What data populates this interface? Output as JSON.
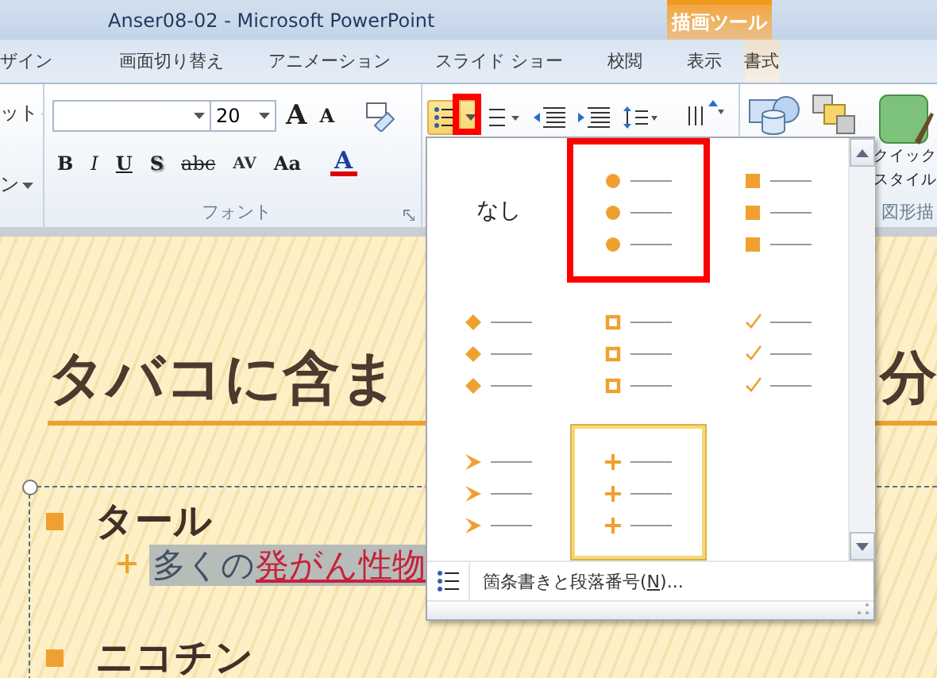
{
  "window": {
    "title": "Anser08-02  -  Microsoft PowerPoint",
    "context_tab": "描画ツール"
  },
  "tabs": [
    {
      "label": "ザイン",
      "selected": false,
      "kind": "normal"
    },
    {
      "label": "画面切り替え",
      "selected": false,
      "kind": "normal"
    },
    {
      "label": "アニメーション",
      "selected": false,
      "kind": "normal"
    },
    {
      "label": "スライド ショー",
      "selected": false,
      "kind": "normal"
    },
    {
      "label": "校閲",
      "selected": false,
      "kind": "normal"
    },
    {
      "label": "表示",
      "selected": false,
      "kind": "normal"
    },
    {
      "label": "書式",
      "selected": false,
      "kind": "contextual"
    }
  ],
  "ribbon": {
    "left_group": {
      "items": [
        "ット",
        "ン"
      ]
    },
    "font_group": {
      "font_size": "20",
      "grow_font": "A",
      "shrink_font": "A",
      "format_buttons": [
        "B",
        "I",
        "U",
        "S",
        "abc",
        "AV",
        "Aa",
        "A"
      ],
      "label": "フォント"
    },
    "paragraph_group": {
      "bullets_selected": true,
      "bullets_dropdown_annotated": true
    },
    "drawing_group": {
      "quick_style": [
        "クイック",
        "スタイル"
      ],
      "label": "図形描"
    }
  },
  "slide": {
    "title_start": "タバコに含ま",
    "title_end": "分",
    "bullets": [
      {
        "text": "タール",
        "children": [
          {
            "text": "多くの",
            "emphasis": "発がん性物",
            "highlighted": true
          }
        ]
      },
      {
        "text": "ニコチン"
      }
    ]
  },
  "bullet_gallery": {
    "items": [
      {
        "kind": "none",
        "label": "なし",
        "selected": false,
        "annotated": false
      },
      {
        "kind": "circle",
        "selected": false,
        "annotated": true
      },
      {
        "kind": "square",
        "selected": false,
        "annotated": false
      },
      {
        "kind": "diamond",
        "selected": false,
        "annotated": false
      },
      {
        "kind": "hollow-square",
        "selected": false,
        "annotated": false
      },
      {
        "kind": "check",
        "selected": false,
        "annotated": false
      },
      {
        "kind": "arrow",
        "selected": false,
        "annotated": false
      },
      {
        "kind": "plus",
        "selected": true,
        "annotated": false
      }
    ],
    "footer": {
      "before": "箇条書きと段落番号(",
      "access_key": "N",
      "after": ")..."
    }
  }
}
